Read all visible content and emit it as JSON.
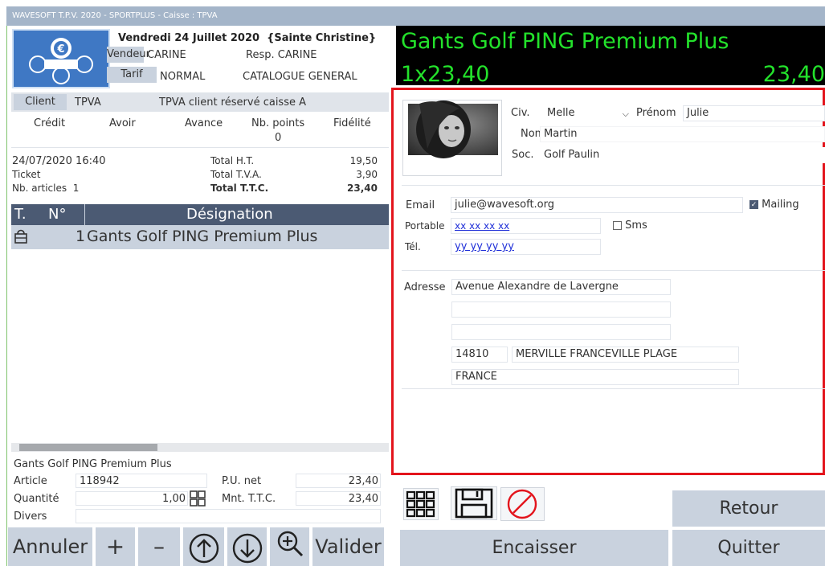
{
  "window": {
    "title": "WAVESOFT T.P.V. 2020 - SPORTPLUS - Caisse : TPVA"
  },
  "header": {
    "date": "Vendredi 24 Juillet 2020",
    "saint": "{Sainte Christine}",
    "vendeur_label": "Vendeur",
    "vendeur_value": "CARINE",
    "resp_label": "Resp.",
    "resp_value": "CARINE",
    "tarif_label": "Tarif",
    "tarif_value": "NORMAL",
    "catalogue": "CATALOGUE GENERAL"
  },
  "client": {
    "label": "Client",
    "code": "TPVA",
    "desc": "TPVA client réservé caisse A",
    "cols": [
      "Crédit",
      "Avoir",
      "Avance",
      "Nb. points",
      "Fidélité"
    ],
    "points": "0"
  },
  "ticket": {
    "datetime": "24/07/2020 16:40",
    "type": "Ticket",
    "nb_articles_label": "Nb. articles",
    "nb_articles": "1",
    "total_ht_label": "Total H.T.",
    "total_ht": "19,50",
    "total_tva_label": "Total T.V.A.",
    "total_tva": "3,90",
    "total_ttc_label": "Total T.T.C.",
    "total_ttc": "23,40"
  },
  "grid": {
    "headers": [
      "T.",
      "N°",
      "Désignation"
    ],
    "rows": [
      {
        "num": "1",
        "designation": "Gants Golf PING Premium Plus"
      }
    ]
  },
  "detail": {
    "designation": "Gants Golf PING Premium Plus",
    "article_label": "Article",
    "article": "118942",
    "pu_label": "P.U. net",
    "pu": "23,40",
    "qty_label": "Quantité",
    "qty": "1,00",
    "mnt_label": "Mnt. T.T.C.",
    "mnt": "23,40",
    "divers_label": "Divers"
  },
  "display": {
    "product": "Gants Golf PING Premium Plus",
    "qty_price": "1x23,40",
    "amount": "23,40"
  },
  "customer_card": {
    "civ_label": "Civ.",
    "civ_value": "Melle",
    "prenom_label": "Prénom",
    "prenom": "Julie",
    "nom_label": "Nom",
    "nom": "Martin",
    "soc_label": "Soc.",
    "soc": "Golf Paulin",
    "email_label": "Email",
    "email": "julie@wavesoft.org",
    "mailing_label": "Mailing",
    "portable_label": "Portable",
    "portable": "xx xx xx xx",
    "sms_label": "Sms",
    "tel_label": "Tél.",
    "tel": "yy yy yy yy",
    "adresse_label": "Adresse",
    "adresse1": "Avenue Alexandre de Lavergne",
    "adresse2": "",
    "adresse3": "",
    "cp": "14810",
    "ville": "MERVILLE FRANCEVILLE PLAGE",
    "pays": "FRANCE"
  },
  "buttons": {
    "retour": "Retour",
    "annuler": "Annuler",
    "plus": "+",
    "minus": "–",
    "valider": "Valider",
    "encaisser": "Encaisser",
    "quitter": "Quitter"
  },
  "colors": {
    "accent_green": "#23e22b",
    "highlight_red": "#e3141c",
    "tile_grey": "#c9d2de",
    "grid_header": "#4b5a73"
  }
}
